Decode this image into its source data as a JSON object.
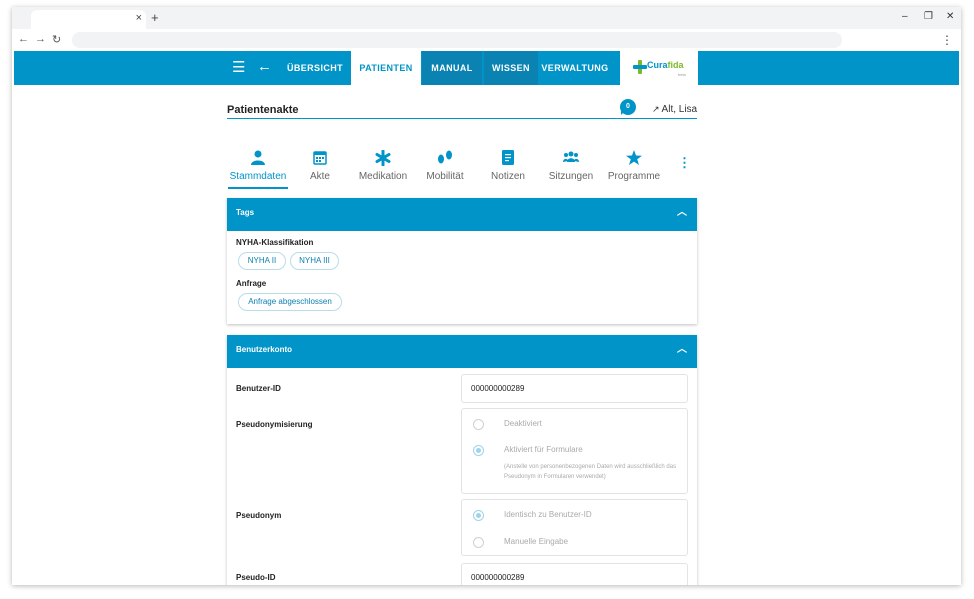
{
  "browser": {
    "close_tab": "×",
    "new_tab": "+",
    "minimize": "–",
    "restore": "❐",
    "close": "✕",
    "back": "←",
    "forward": "→",
    "reload": "↻",
    "menu": "⋮"
  },
  "nav": {
    "menu_icon": "☰",
    "back_icon": "←",
    "items": [
      "ÜBERSICHT",
      "PATIENTEN",
      "MANUAL",
      "WISSEN",
      "VERWALTUNG"
    ],
    "logo_part1": "Cura",
    "logo_part2": "fida",
    "logo_sub": "beta"
  },
  "page": {
    "title": "Patientenakte",
    "badge_count": "0",
    "patient_name": "Alt, Lisa"
  },
  "tabs": [
    {
      "label": "Stammdaten",
      "icon": "person-icon"
    },
    {
      "label": "Akte",
      "icon": "calendar-icon"
    },
    {
      "label": "Medikation",
      "icon": "asterisk-icon"
    },
    {
      "label": "Mobilität",
      "icon": "footsteps-icon"
    },
    {
      "label": "Notizen",
      "icon": "note-icon"
    },
    {
      "label": "Sitzungen",
      "icon": "group-icon"
    },
    {
      "label": "Programme",
      "icon": "star-icon"
    }
  ],
  "tags_card": {
    "title": "Tags",
    "nyha_label": "NYHA-Klassifikation",
    "nyha_chips": [
      "NYHA II",
      "NYHA III"
    ],
    "anfrage_label": "Anfrage",
    "anfrage_chips": [
      "Anfrage abgeschlossen"
    ]
  },
  "account_card": {
    "title": "Benutzerkonto",
    "user_id_label": "Benutzer-ID",
    "user_id_value": "000000000289",
    "pseudonymization_label": "Pseudonymisierung",
    "pseudo_option_1": "Deaktiviert",
    "pseudo_option_2": "Aktiviert für Formulare",
    "pseudo_hint": "(Anstelle von personenbezogenen Daten wird ausschließlich das Pseudonym in Formularen verwendet)",
    "pseudonym_label": "Pseudonym",
    "pseudonym_option_1": "Identisch zu Benutzer-ID",
    "pseudonym_option_2": "Manuelle Eingabe",
    "pseudo_id_label": "Pseudo-ID",
    "pseudo_id_value": "000000000289"
  }
}
